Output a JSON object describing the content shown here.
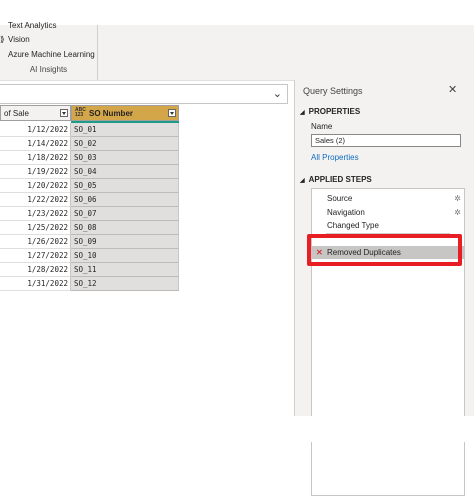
{
  "ribbon": {
    "items": [
      {
        "icon": "text-analytics-icon",
        "glyph": "",
        "label": "Text Analytics"
      },
      {
        "icon": "vision-icon",
        "glyph": "⟫",
        "label": "Vision"
      },
      {
        "icon": "azure-ml-icon",
        "glyph": "",
        "label": "Azure Machine Learning"
      }
    ],
    "group_label": "AI Insights"
  },
  "formula_bar": {
    "chevron": "⌄"
  },
  "grid": {
    "columns": [
      {
        "label": "of Sale",
        "type_icon": ""
      },
      {
        "label": "SO Number",
        "type_icon": "ABC 123"
      }
    ],
    "rows": [
      {
        "date": "1/12/2022",
        "so": "SO_01"
      },
      {
        "date": "1/14/2022",
        "so": "SO_02"
      },
      {
        "date": "1/18/2022",
        "so": "SO_03"
      },
      {
        "date": "1/19/2022",
        "so": "SO_04"
      },
      {
        "date": "1/20/2022",
        "so": "SO_05"
      },
      {
        "date": "1/22/2022",
        "so": "SO_06"
      },
      {
        "date": "1/23/2022",
        "so": "SO_07"
      },
      {
        "date": "1/25/2022",
        "so": "SO_08"
      },
      {
        "date": "1/26/2022",
        "so": "SO_09"
      },
      {
        "date": "1/27/2022",
        "so": "SO_10"
      },
      {
        "date": "1/28/2022",
        "so": "SO_11"
      },
      {
        "date": "1/31/2022",
        "so": "SO_12"
      }
    ],
    "header_accent": "#d4a64a"
  },
  "query_settings": {
    "title": "Query Settings",
    "close": "✕",
    "properties_label": "PROPERTIES",
    "name_label": "Name",
    "name_value": "Sales (2)",
    "all_properties_link": "All Properties",
    "applied_steps_label": "APPLIED STEPS",
    "steps": [
      {
        "label": "Source",
        "gear": "✲"
      },
      {
        "label": "Navigation",
        "gear": "✲"
      },
      {
        "label": "Changed Type",
        "gear": ""
      },
      {
        "label": "Removed Duplicates",
        "gear": "",
        "selected": true
      }
    ],
    "highlight_color": "#e81e25"
  }
}
